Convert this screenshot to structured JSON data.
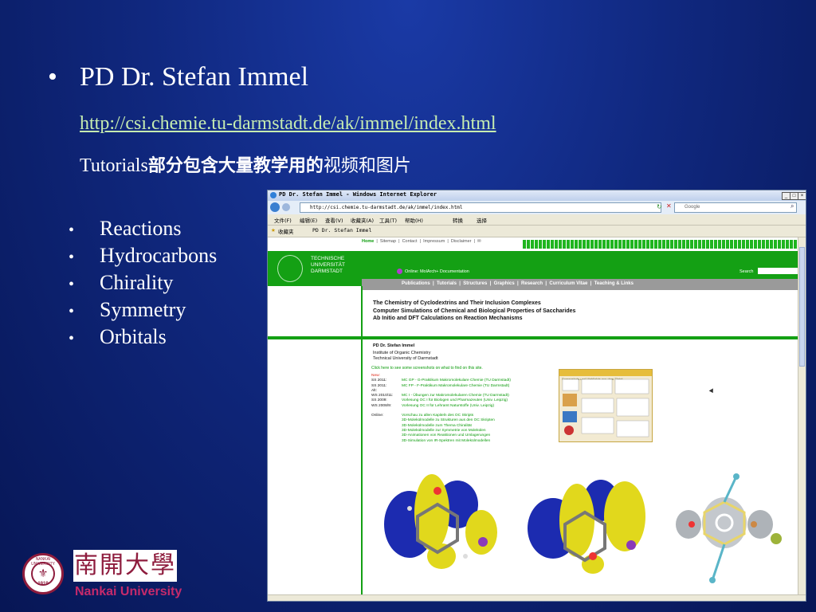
{
  "slide": {
    "title": "PD Dr. Stefan Immel",
    "url": "http://csi.chemie.tu-darmstadt.de/ak/immel/index.html",
    "note_prefix": "Tutorials",
    "note_bold": "部分包含大量教学用的",
    "note_rest": "视频和图片",
    "topics": [
      "Reactions",
      "Hydrocarbons",
      "Chirality",
      "Symmetry",
      "Orbitals"
    ],
    "logo": {
      "calligraphy": "南開大學",
      "name": "Nankai University",
      "seal_text": "NANKAI UNIVERSITY",
      "seal_year": "1919"
    }
  },
  "browser": {
    "title": "PD Dr. Stefan Immel - Windows Internet Explorer",
    "address": "http://csi.chemie.tu-darmstadt.de/ak/immel/index.html",
    "search_placeholder": "Google",
    "menu": [
      "文件(F)",
      "编辑(E)",
      "查看(V)",
      "收藏夹(A)",
      "工具(T)",
      "帮助(H)",
      "转换",
      "选择"
    ],
    "favorites_label": "收藏夹",
    "tab_title": "PD Dr. Stefan Immel"
  },
  "webpage": {
    "topnav": [
      "Home",
      "Sitemap",
      "Contact",
      "Impressum",
      "Disclaimer"
    ],
    "university": [
      "TECHNISCHE",
      "UNIVERSITÄT",
      "DARMSTADT"
    ],
    "online_text": "Online: MolArch+ Documentation",
    "search_label": "Search",
    "subnav": [
      "Publications",
      "Tutorials",
      "Structures",
      "Graphics",
      "Research",
      "Curriculum Vitae",
      "Teaching & Links"
    ],
    "headings": [
      "The Chemistry of Cyclodextrins and Their Inclusion Complexes",
      "Computer Simulations of Chemical and Biological Properties of Saccharides",
      "Ab Initio and DFT Calculations on Reaction Mechanisms"
    ],
    "person": "PD Dr. Stefan Immel",
    "institute": [
      "Institute of Organic Chemistry",
      "Technical University of Darmstadt"
    ],
    "click_here": "Click here to see some screenshots on what to find on this site.",
    "courses": [
      {
        "k": "New:",
        "v": ""
      },
      {
        "k": "SS 2011:",
        "v": "MC GP - G-Praktikum Makromolekulare Chemie (TU Darmstadt)"
      },
      {
        "k": "SS 2011:",
        "v": "MC FP - F-Praktikum Makromolekulare Chemie (TU Darmstadt)"
      },
      {
        "k": "Alt:",
        "v": ""
      },
      {
        "k": "WS 2010/11:",
        "v": "MC I - Übungen zur Makromolekularen Chemie (TU Darmstadt)"
      },
      {
        "k": "SS 2009:",
        "v": "Vorlesung OC I für Biologen und Pharmazeuten (Univ. Leipzig)"
      },
      {
        "k": "WS 2008/9:",
        "v": "Vorlesung OC II für Lehramt Naturstoffe (Univ. Leipzig)"
      },
      {
        "k": "",
        "v": ""
      },
      {
        "k": "Online:",
        "v": "Vorschau zu allen Kapiteln des OC Skripts"
      },
      {
        "k": "",
        "v": "3D-Molekülmodelle zu Strukturen aus den OC Skripten"
      },
      {
        "k": "",
        "v": "3D-Molekülmodelle zum Thema Chiralität"
      },
      {
        "k": "",
        "v": "3D-Molekülmodelle zur Symmetrie von Molekülen"
      },
      {
        "k": "",
        "v": "3D-Animationen von Reaktionen und Umlagerungen"
      },
      {
        "k": "",
        "v": "3D-Simulation von IR-Spektren mit Molekülmodellen"
      }
    ],
    "thumb_title": "Screenshots und Highlights aus dem Skript"
  },
  "colors": {
    "accent_green": "#14a014",
    "slide_bg": "#10287f",
    "link_green": "#c6ecb0",
    "nankai_red": "#8e1c3d"
  }
}
